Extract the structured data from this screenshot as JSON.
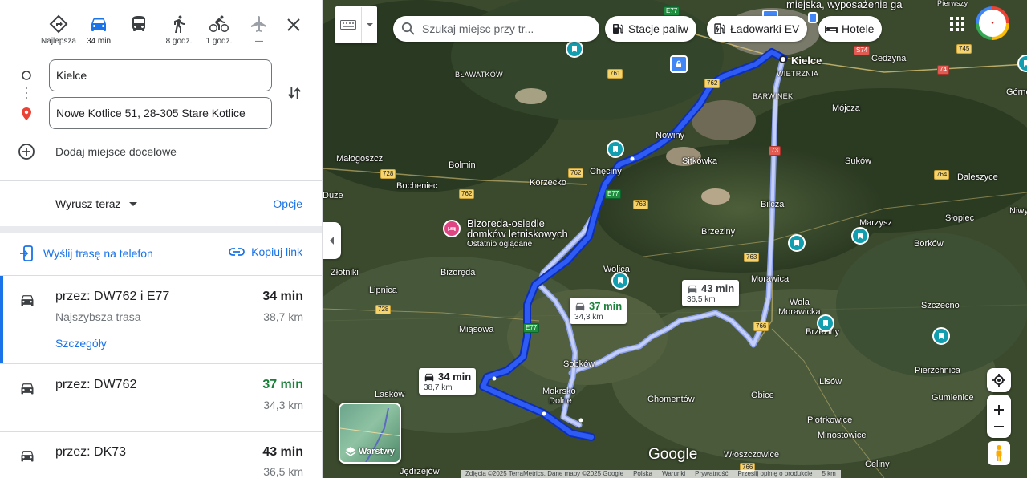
{
  "modes": [
    {
      "name": "mode-best",
      "label": "Najlepsza",
      "icon": "diamond-directions-icon",
      "active": false
    },
    {
      "name": "mode-car",
      "label": "34 min",
      "icon": "car-icon",
      "active": true
    },
    {
      "name": "mode-transit",
      "label": "",
      "icon": "bus-icon",
      "active": false
    },
    {
      "name": "mode-walk",
      "label": "8 godz.",
      "icon": "walk-icon",
      "active": false
    },
    {
      "name": "mode-bike",
      "label": "1 godz.",
      "icon": "bike-icon",
      "active": false
    },
    {
      "name": "mode-flight",
      "label": "—",
      "icon": "plane-icon",
      "active": false
    }
  ],
  "waypoints": {
    "origin": "Kielce",
    "destination": "Nowe Kotlice 51, 28-305 Stare Kotlice",
    "add_destination": "Dodaj miejsce docelowe"
  },
  "depart": {
    "label": "Wyrusz teraz",
    "options": "Opcje"
  },
  "share": {
    "send_to_phone": "Wyślij trasę na telefon",
    "copy_link": "Kopiuj link"
  },
  "routes": [
    {
      "via": "przez: DW762 i E77",
      "sub": "Najszybsza trasa",
      "time": "34 min",
      "distance": "38,7 km",
      "details": "Szczegóły"
    },
    {
      "via": "przez: DW762",
      "time": "37 min",
      "distance": "34,3 km"
    },
    {
      "via": "przez: DK73",
      "time": "43 min",
      "distance": "36,5 km"
    }
  ],
  "map": {
    "search_placeholder": "Szukaj miejsc przy tr...",
    "chips": [
      "Stacje paliw",
      "Ładowarki EV",
      "Hotele"
    ],
    "top_banner": "miejska, wyposażenie ga",
    "poi": {
      "name_line1": "Bizoreda-osiedle",
      "name_line2": "domków letniskowych",
      "note": "Ostatnio oglądane"
    },
    "labels": {
      "kielce": "Kielce",
      "wietrznia": "WIETRZNIA",
      "barwinek": "BARWINEK",
      "bialogon": "BŁAWATKÓW",
      "malogoszcz": "Małogoszcz",
      "bolmin": "Bolmin",
      "bocheniec": "Bocheniec",
      "duze": "Duże",
      "korzecko": "Korzecko",
      "checiny": "Chęciny",
      "nowiny": "Nowiny",
      "sitkowka": "Sitkówka",
      "mojcza": "Mójcza",
      "cedzyna": "Cedzyna",
      "gorno": "Górno",
      "pierwszy": "Pierwszy",
      "sukow": "Suków",
      "daleszyce": "Daleszyce",
      "bilcza": "Bilcza",
      "marzysz": "Marzysz",
      "slopiec": "Słopiec",
      "niwy": "Niwy",
      "borkow": "Borków",
      "brzeziny": "Brzeziny",
      "zlotniki": "Złotniki",
      "lipnica": "Lipnica",
      "bizoreda": "Bizoręda",
      "wolica": "Wolica",
      "morawica": "Morawica",
      "wola_morawicka1": "Wola",
      "wola_morawicka2": "Morawicka",
      "szczecno": "Szczecno",
      "bedzow": "Brzeziny",
      "miasowa": "Miąsowa",
      "sobkow": "Sobków",
      "pierzchnica": "Pierzchnica",
      "laskow": "Lasków",
      "mokrsko1": "Mokrsko",
      "mokrsko2": "Dolne",
      "chomentow": "Chomentów",
      "obice": "Obice",
      "lisow": "Lisów",
      "gumienice": "Gumienice",
      "piotrkowice": "Piotrkowice",
      "minostowice": "Minostowice",
      "wloszczowice": "Włoszczowice",
      "celiny": "Celiny",
      "jedrzejow": "Jędrzejów"
    },
    "roads": [
      "E77",
      "761",
      "762",
      "762",
      "762",
      "762",
      "763",
      "763",
      "728",
      "728",
      "S74",
      "745",
      "74",
      "73",
      "764",
      "766",
      "766",
      "E77",
      "E77"
    ],
    "route_labels": [
      {
        "time": "34 min",
        "distance": "38,7 km"
      },
      {
        "time": "37 min",
        "distance": "34,3 km"
      },
      {
        "time": "43 min",
        "distance": "36,5 km"
      }
    ],
    "layers_label": "Warstwy",
    "google": "Google",
    "attribution": [
      "Zdjęcia ©2025 TerraMetrics, Dane mapy ©2025 Google",
      "Polska",
      "Warunki",
      "Prywatność",
      "Prześlij opinię o produkcie",
      "5 km"
    ]
  },
  "colors": {
    "accent": "#1a73e8",
    "route_main": "#1a3fe0",
    "route_alt": "#b7c4f8",
    "green_time": "#188038"
  }
}
